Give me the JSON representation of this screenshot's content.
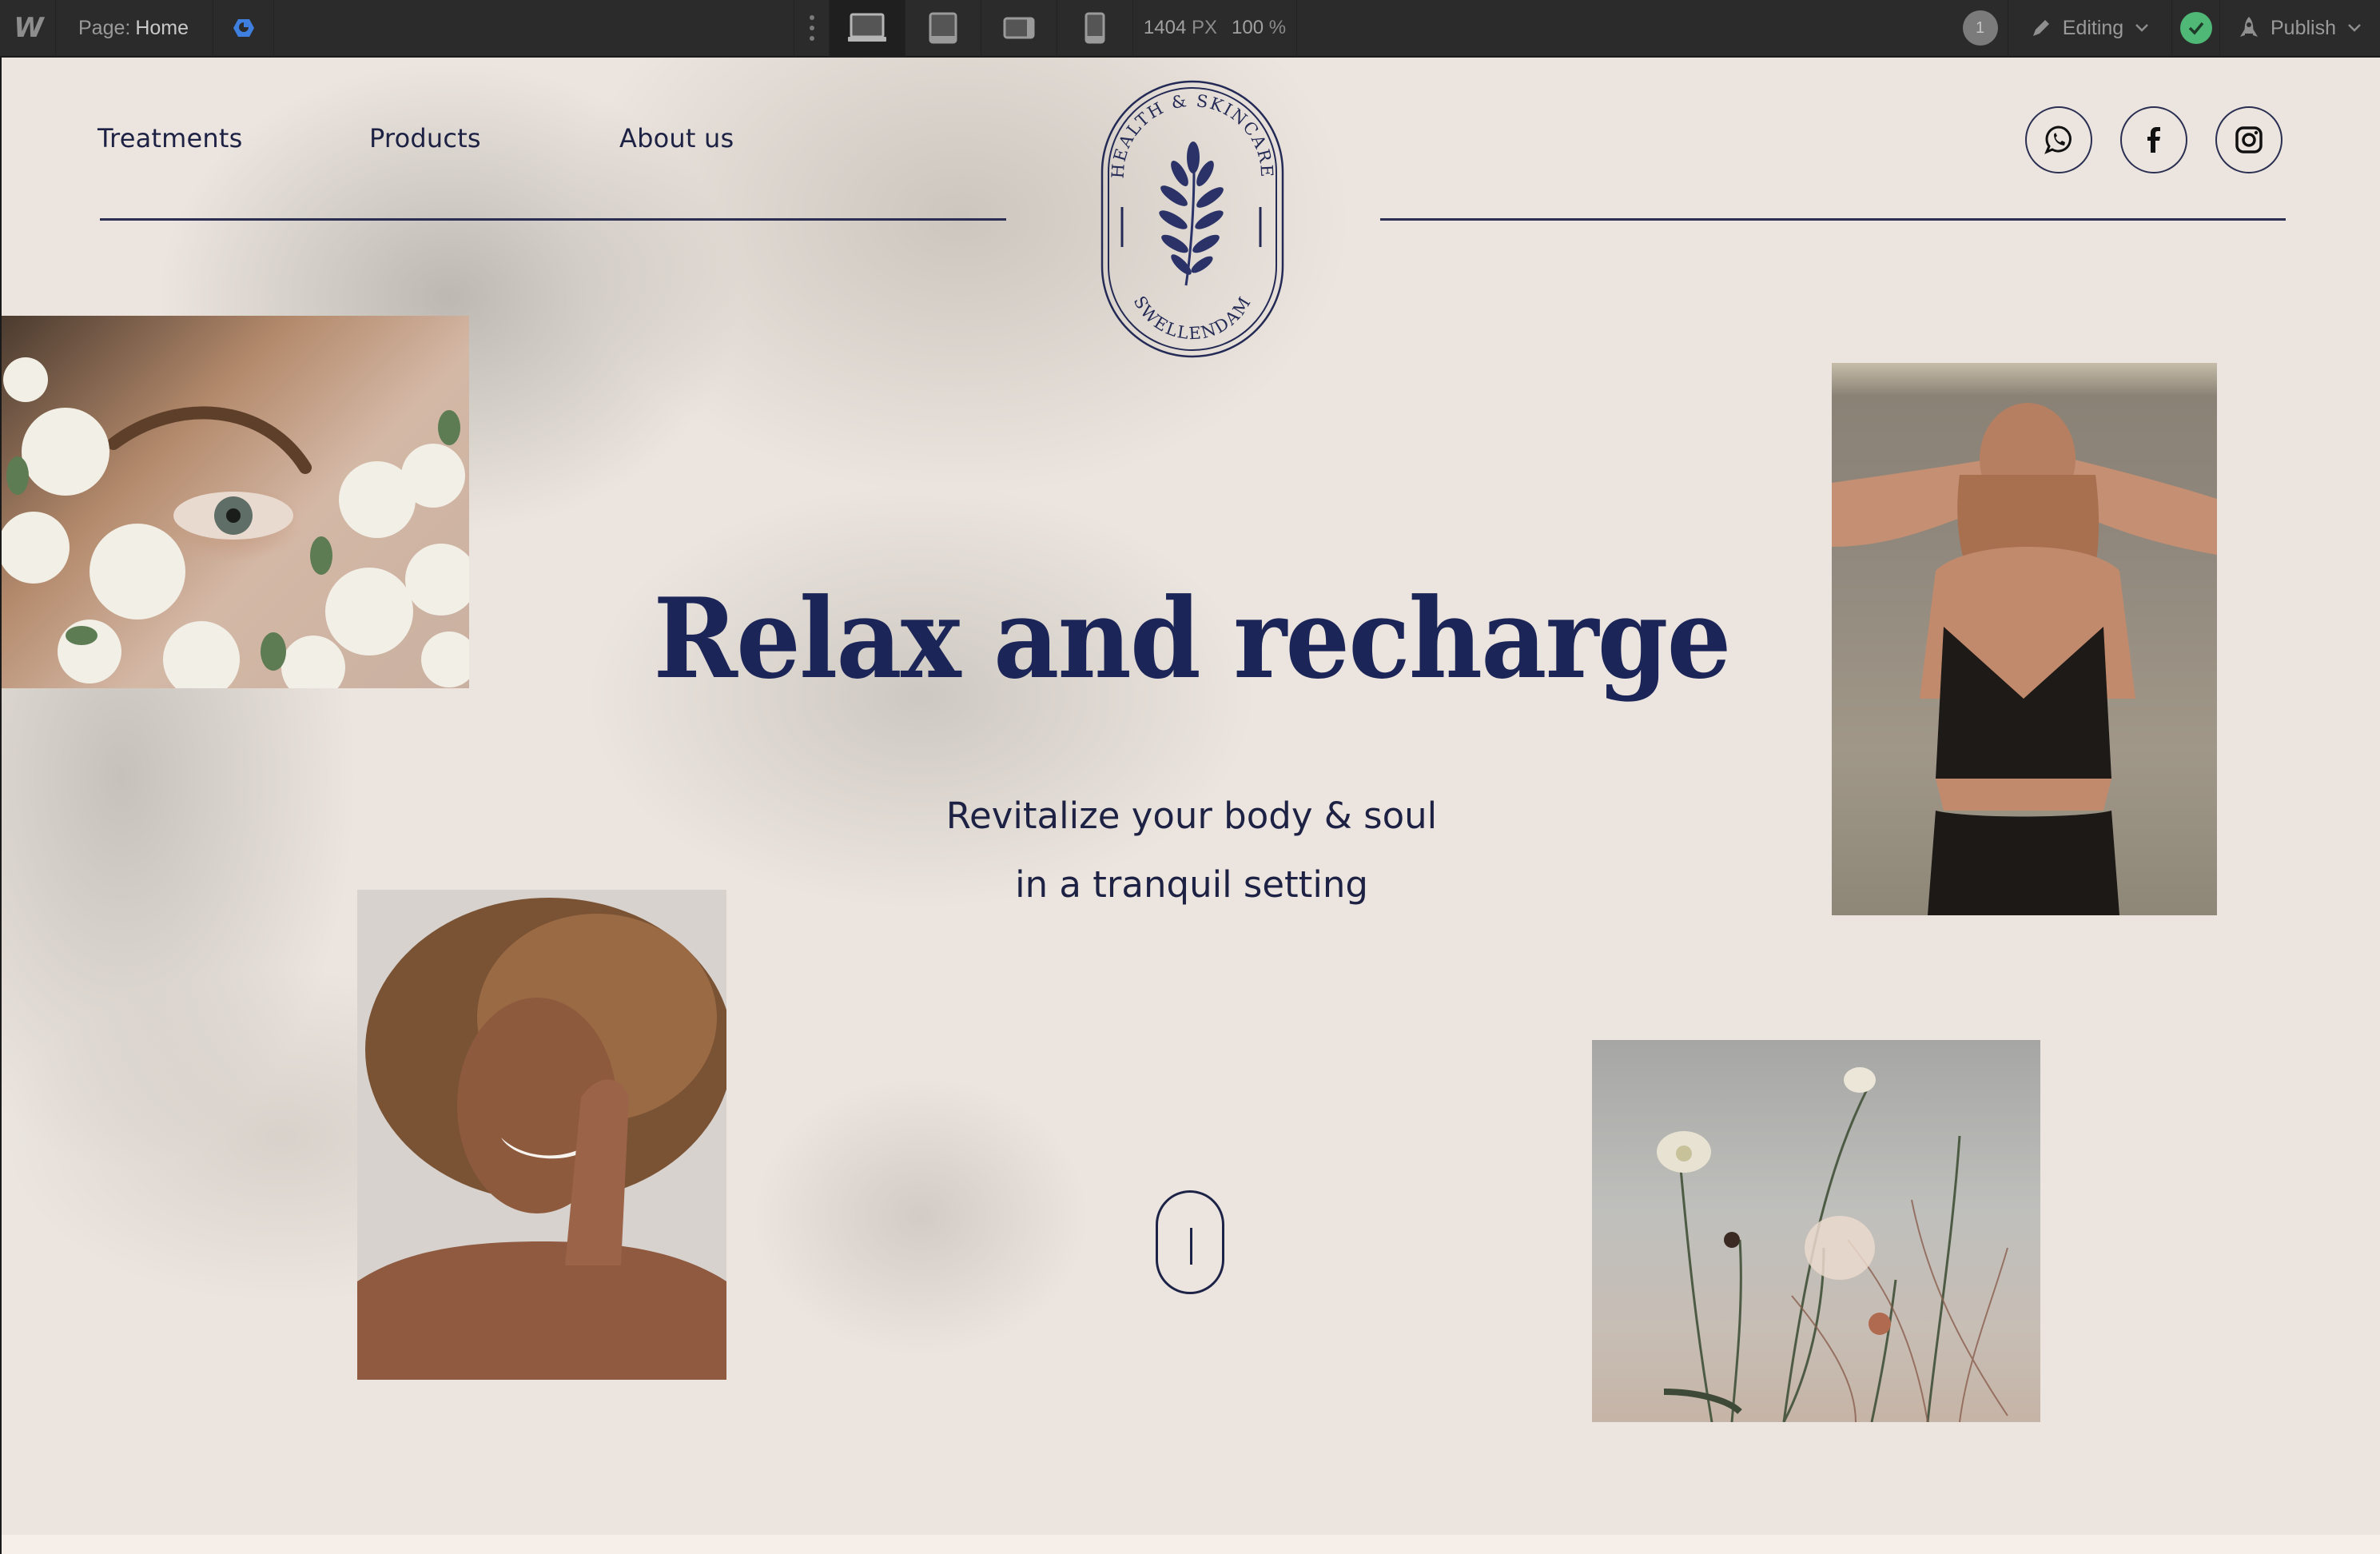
{
  "toolbar": {
    "logo": "W",
    "page_label": "Page:",
    "page_name": "Home",
    "preview_icon": "eye-icon",
    "more_icon": "vertical-dots-icon",
    "devices": [
      {
        "name": "desktop",
        "icon": "laptop-icon",
        "active": true
      },
      {
        "name": "tablet",
        "icon": "tablet-icon",
        "active": false
      },
      {
        "name": "mobile-landscape",
        "icon": "phone-landscape-icon",
        "active": false
      },
      {
        "name": "mobile-portrait",
        "icon": "phone-portrait-icon",
        "active": false
      }
    ],
    "width_value": "1404",
    "width_unit": "PX",
    "zoom_value": "100",
    "zoom_unit": "%",
    "collaborators_count": "1",
    "mode_label": "Editing",
    "status": "saved",
    "publish_label": "Publish",
    "colors": {
      "bg": "#2b2b2b",
      "preview": "#3f7fe0",
      "check": "#4fb877"
    }
  },
  "site": {
    "nav": [
      {
        "label": "Treatments"
      },
      {
        "label": "Products"
      },
      {
        "label": "About us"
      }
    ],
    "logo": {
      "top_text": "HEALTH & SKINCARE",
      "bottom_text": "SWELLENDAM",
      "icon": "leaf-branch-icon"
    },
    "social": [
      {
        "name": "whatsapp",
        "icon": "whatsapp-icon"
      },
      {
        "name": "facebook",
        "icon": "facebook-icon"
      },
      {
        "name": "instagram",
        "icon": "instagram-icon"
      }
    ],
    "hero": {
      "title": "Relax and recharge",
      "subtitle_line1": "Revitalize your body & soul",
      "subtitle_line2": "in a tranquil setting"
    },
    "photos": [
      {
        "name": "eye-with-white-flowers"
      },
      {
        "name": "woman-covering-eyes"
      },
      {
        "name": "smiling-woman-curly-hair"
      },
      {
        "name": "wildflowers"
      }
    ],
    "colors": {
      "navy": "#1c2557",
      "background": "#ece5df"
    }
  }
}
